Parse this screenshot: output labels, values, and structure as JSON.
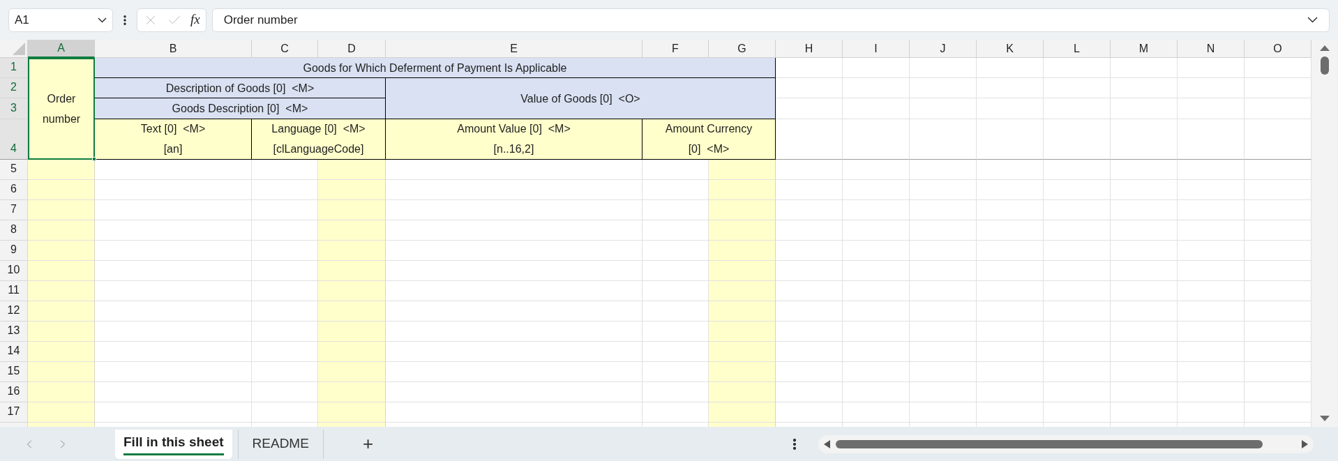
{
  "formula_bar": {
    "name_box": "A1",
    "function_label": "fx",
    "formula": "Order number"
  },
  "columns": [
    {
      "label": "A",
      "selected": true,
      "highlighted": true
    },
    {
      "label": "B",
      "selected": false,
      "highlighted": false
    },
    {
      "label": "C",
      "selected": false,
      "highlighted": false
    },
    {
      "label": "D",
      "selected": false,
      "highlighted": true
    },
    {
      "label": "E",
      "selected": false,
      "highlighted": false
    },
    {
      "label": "F",
      "selected": false,
      "highlighted": false
    },
    {
      "label": "G",
      "selected": false,
      "highlighted": true
    },
    {
      "label": "H",
      "selected": false,
      "highlighted": false
    },
    {
      "label": "I",
      "selected": false,
      "highlighted": false
    },
    {
      "label": "J",
      "selected": false,
      "highlighted": false
    },
    {
      "label": "K",
      "selected": false,
      "highlighted": false
    },
    {
      "label": "L",
      "selected": false,
      "highlighted": false
    },
    {
      "label": "M",
      "selected": false,
      "highlighted": false
    },
    {
      "label": "N",
      "selected": false,
      "highlighted": false
    },
    {
      "label": "O",
      "selected": false,
      "highlighted": false
    }
  ],
  "rows": [
    {
      "label": "1",
      "selected": true
    },
    {
      "label": "2",
      "selected": true
    },
    {
      "label": "3",
      "selected": true
    },
    {
      "label": "4",
      "selected": true
    },
    {
      "label": "5",
      "selected": false
    },
    {
      "label": "6",
      "selected": false
    },
    {
      "label": "7",
      "selected": false
    },
    {
      "label": "8",
      "selected": false
    },
    {
      "label": "9",
      "selected": false
    },
    {
      "label": "10",
      "selected": false
    },
    {
      "label": "11",
      "selected": false
    },
    {
      "label": "12",
      "selected": false
    },
    {
      "label": "13",
      "selected": false
    },
    {
      "label": "14",
      "selected": false
    },
    {
      "label": "15",
      "selected": false
    },
    {
      "label": "16",
      "selected": false
    },
    {
      "label": "17",
      "selected": false
    }
  ],
  "header_cells": [
    {
      "lines": [
        "Order",
        "number"
      ],
      "color": "#ffffcc",
      "selected": true
    },
    {
      "lines": [
        "Goods for Which Deferment of Payment Is Applicable"
      ],
      "color": "#d9e1f2",
      "selected": false
    },
    {
      "lines": [
        "Description of Goods [0]  <M>"
      ],
      "color": "#d9e1f2",
      "selected": false
    },
    {
      "lines": [
        "Value of Goods [0]  <O>"
      ],
      "color": "#d9e1f2",
      "selected": false
    },
    {
      "lines": [
        "Goods Description [0]  <M>"
      ],
      "color": "#d9e1f2",
      "selected": false
    },
    {
      "lines": [
        "Text [0]  <M>",
        "[an]"
      ],
      "color": "#ffffcc",
      "selected": false
    },
    {
      "lines": [
        "Language [0]  <M>",
        "[clLanguageCode]"
      ],
      "color": "#ffffcc",
      "selected": false
    },
    {
      "lines": [
        "Amount Value [0]  <M>",
        "[n..16,2]"
      ],
      "color": "#ffffcc",
      "selected": false
    },
    {
      "lines": [
        "Amount Currency",
        "[0]  <M>"
      ],
      "color": "#ffffcc",
      "selected": false
    }
  ],
  "sheet_tabs": [
    {
      "label": "Fill in this sheet",
      "selected": true
    },
    {
      "label": "README",
      "selected": false
    }
  ],
  "add_sheet": "+"
}
